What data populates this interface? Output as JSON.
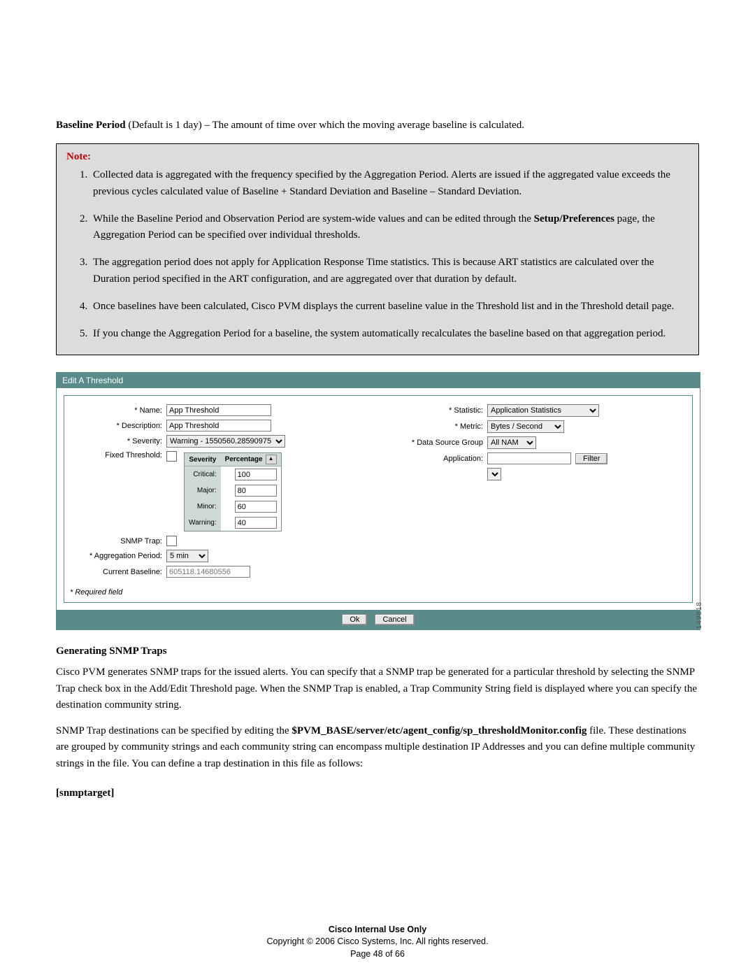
{
  "intro": {
    "label": "Baseline Period",
    "rest": " (Default is 1 day) – The amount of time over which the moving average baseline is calculated."
  },
  "note_title": "Note:",
  "notes": [
    {
      "pre": "Collected data is aggregated with the frequency specified by the Aggregation Period. Alerts are issued if the aggregated value exceeds the previous cycles calculated value of Baseline + Standard Deviation and Baseline – Standard Deviation."
    },
    {
      "pre": "While the Baseline Period and Observation Period are system-wide values and can be edited through the ",
      "bold": "Setup/Preferences",
      "post": " page, the Aggregation Period can be specified over individual thresholds."
    },
    {
      "pre": "The aggregation period does not apply for Application Response Time statistics. This is because ART statistics are calculated over the Duration period specified in the ART configuration, and are aggregated over that duration by default."
    },
    {
      "pre": "Once baselines have been calculated, Cisco PVM displays the current baseline value in the Threshold list and in the Threshold detail page."
    },
    {
      "pre": "If you change the Aggregation Period for a baseline, the system automatically recalculates the baseline based on that aggregation period."
    }
  ],
  "dialog": {
    "title": "Edit A Threshold",
    "name_label": "* Name:",
    "name_value": "App Threshold",
    "desc_label": "* Description:",
    "desc_value": "App Threshold",
    "severity_label": "* Severity:",
    "severity_value": "Warning - 1550560.28590975",
    "fixed_label": "Fixed Threshold:",
    "table_hdr1": "Severity",
    "table_hdr2": "Percentage",
    "rows": [
      {
        "label": "Critical:",
        "val": "100"
      },
      {
        "label": "Major:",
        "val": "80"
      },
      {
        "label": "Minor:",
        "val": "60"
      },
      {
        "label": "Warning:",
        "val": "40"
      }
    ],
    "snmp_label": "SNMP Trap:",
    "agg_label": "* Aggregation Period:",
    "agg_value": "5  min",
    "baseline_label": "Current Baseline:",
    "baseline_value": "605118.14680556",
    "stat_label": "* Statistic:",
    "stat_value": "Application Statistics",
    "metric_label": "* Metric:",
    "metric_value": "Bytes / Second",
    "dsg_label": "* Data Source Group",
    "dsg_value": "All NAM",
    "app_label": "Application:",
    "filter_btn": "Filter",
    "required": "* Required field",
    "ok": "Ok",
    "cancel": "Cancel",
    "fig_id": "149818"
  },
  "heading1": "Generating SNMP Traps",
  "para1": "Cisco PVM generates SNMP traps for the issued alerts. You can specify that a SNMP trap be generated for a particular threshold by selecting the SNMP Trap check box in the Add/Edit Threshold page. When the SNMP Trap is enabled, a Trap Community String field is displayed where you can specify the destination community string.",
  "para2": {
    "pre": "SNMP Trap destinations can be specified by editing the ",
    "bold": "$PVM_BASE/server/etc/agent_config/sp_thresholdMonitor.config",
    "post": " file.  These destinations are grouped by community strings and each community string can encompass multiple destination IP Addresses and you can define multiple community strings in the file. You can define a trap destination in this file as follows:"
  },
  "heading2": "[snmptarget]",
  "footer": {
    "l1": "Cisco Internal Use Only",
    "l2": "Copyright © 2006 Cisco Systems, Inc. All rights reserved.",
    "l3": "Page 48 of 66"
  }
}
